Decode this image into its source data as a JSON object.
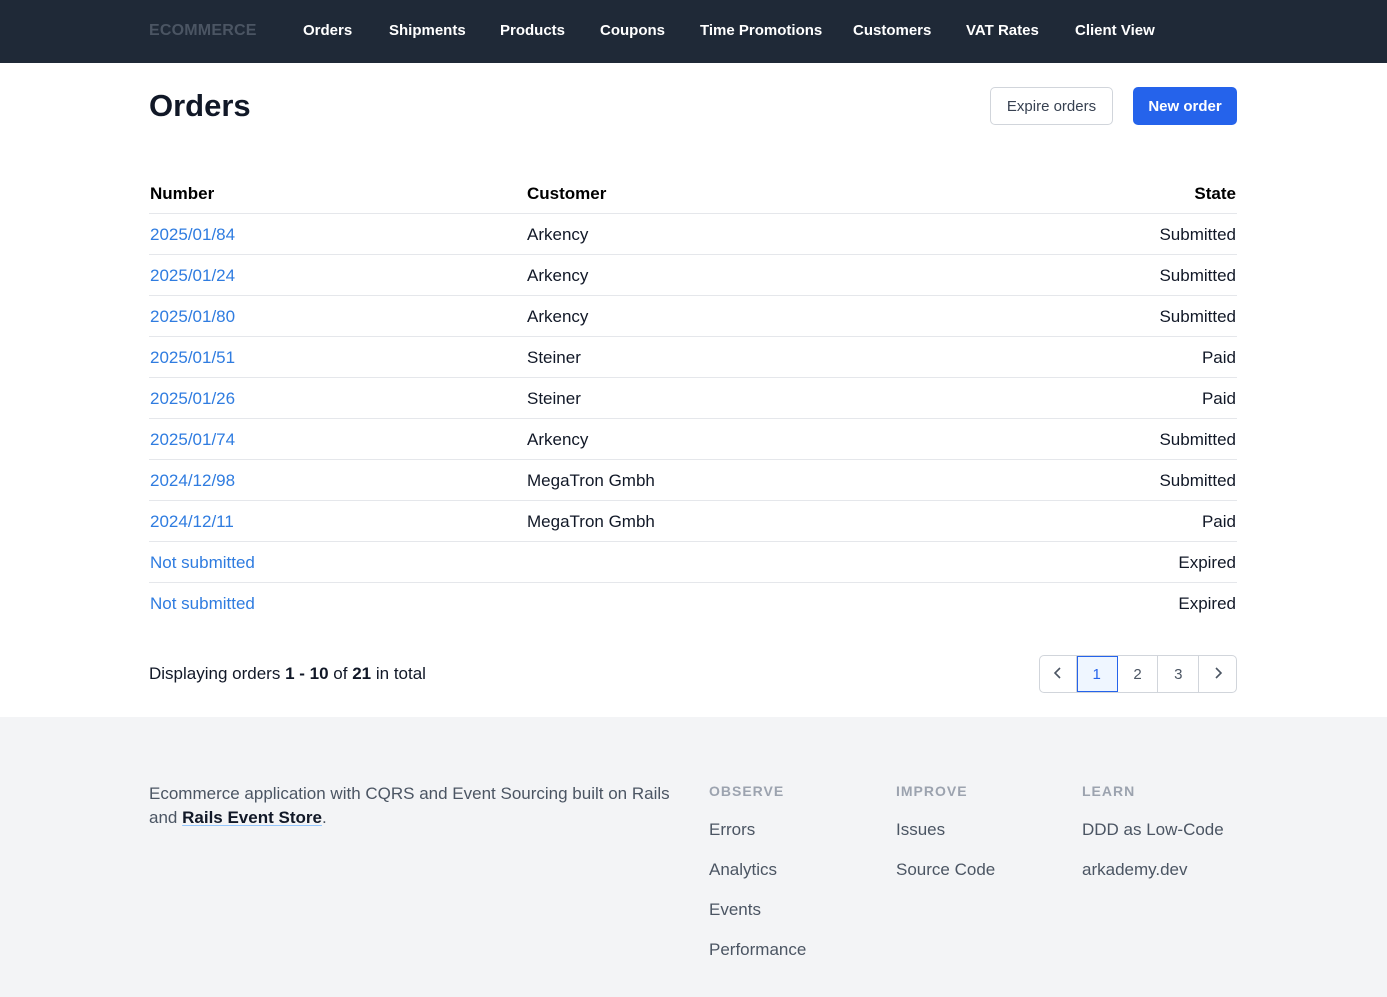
{
  "nav": {
    "brand": "ECOMMERCE",
    "links": [
      "Orders",
      "Shipments",
      "Products",
      "Coupons",
      "Time Promotions",
      "Customers",
      "VAT Rates",
      "Client View"
    ]
  },
  "header": {
    "title": "Orders",
    "expire_label": "Expire orders",
    "new_label": "New order"
  },
  "table": {
    "columns": [
      "Number",
      "Customer",
      "State"
    ],
    "rows": [
      {
        "number": "2025/01/84",
        "customer": "Arkency",
        "state": "Submitted"
      },
      {
        "number": "2025/01/24",
        "customer": "Arkency",
        "state": "Submitted"
      },
      {
        "number": "2025/01/80",
        "customer": "Arkency",
        "state": "Submitted"
      },
      {
        "number": "2025/01/51",
        "customer": "Steiner",
        "state": "Paid"
      },
      {
        "number": "2025/01/26",
        "customer": "Steiner",
        "state": "Paid"
      },
      {
        "number": "2025/01/74",
        "customer": "Arkency",
        "state": "Submitted"
      },
      {
        "number": "2024/12/98",
        "customer": "MegaTron Gmbh",
        "state": "Submitted"
      },
      {
        "number": "2024/12/11",
        "customer": "MegaTron Gmbh",
        "state": "Paid"
      },
      {
        "number": "Not submitted",
        "customer": "",
        "state": "Expired"
      },
      {
        "number": "Not submitted",
        "customer": "",
        "state": "Expired"
      }
    ]
  },
  "summary": {
    "prefix": "Displaying orders",
    "range": "1 - 10",
    "of": "of",
    "total": "21",
    "suffix": "in total"
  },
  "pagination": {
    "pages": [
      "1",
      "2",
      "3"
    ],
    "current": "1",
    "prev_icon": "chevron-left-icon",
    "next_icon": "chevron-right-icon"
  },
  "footer": {
    "description": "Ecommerce application with CQRS and Event Sourcing built on Rails and",
    "description_link": "Rails Event Store",
    "description_end": ".",
    "columns": [
      {
        "heading": "OBSERVE",
        "links": [
          "Errors",
          "Analytics",
          "Events",
          "Performance"
        ]
      },
      {
        "heading": "IMPROVE",
        "links": [
          "Issues",
          "Source Code"
        ]
      },
      {
        "heading": "LEARN",
        "links": [
          "DDD as Low-Code",
          "arkademy.dev"
        ]
      }
    ]
  },
  "colors": {
    "nav_bg": "#1f2937",
    "primary": "#2563eb",
    "link": "#2f7ce0",
    "footer_bg": "#f3f4f6"
  }
}
